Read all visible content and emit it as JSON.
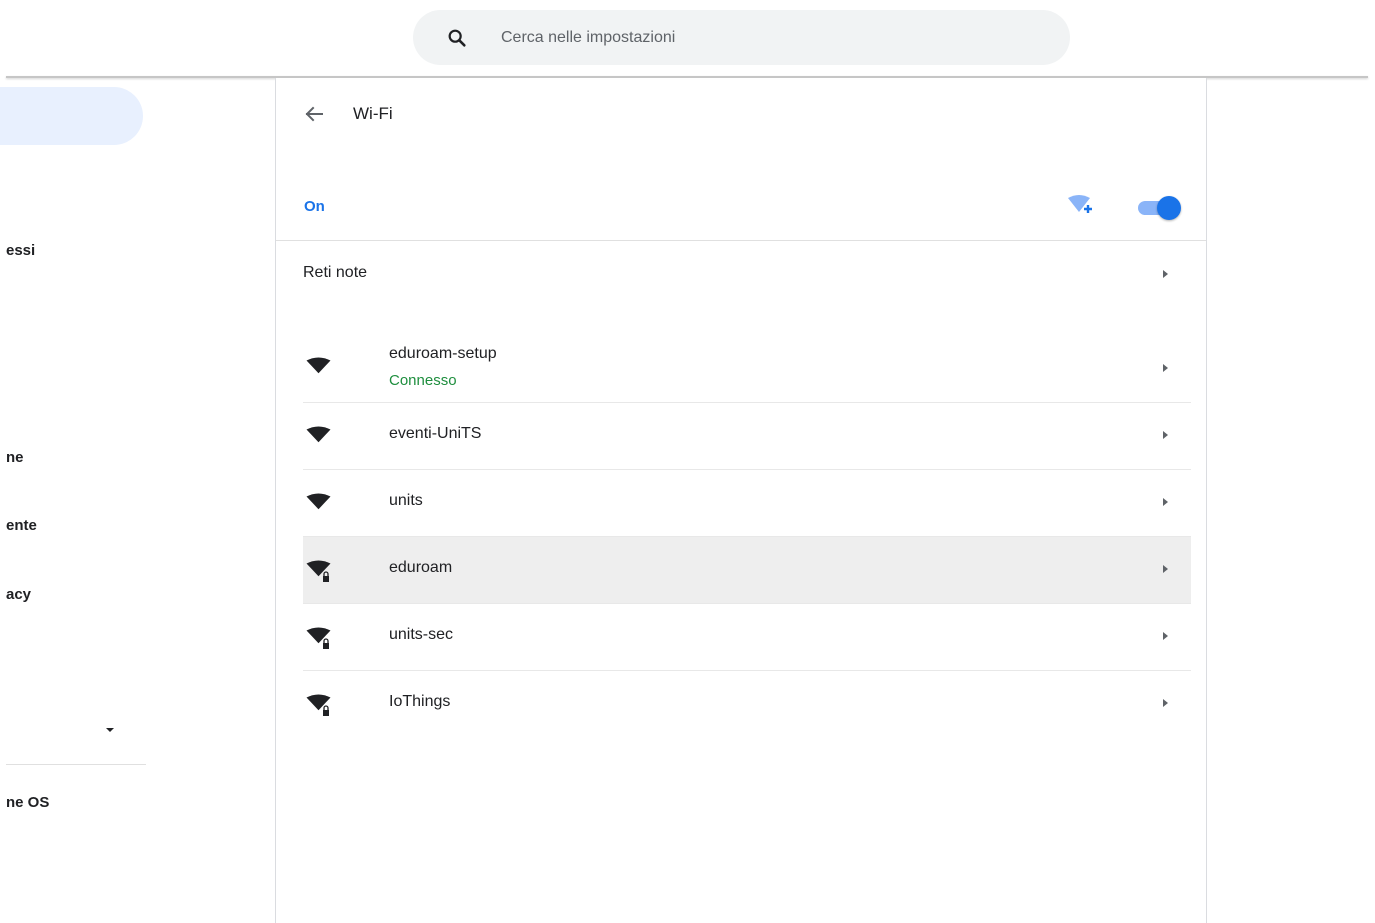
{
  "search": {
    "placeholder": "Cerca nelle impostazioni"
  },
  "sidebar": {
    "items": [
      {
        "label": "essi"
      },
      {
        "label": "ne"
      },
      {
        "label": "ente"
      },
      {
        "label": "acy"
      },
      {
        "label": "ne OS"
      }
    ]
  },
  "wifi": {
    "title": "Wi-Fi",
    "state_label": "On",
    "toggle_on": true,
    "known_networks_label": "Reti note",
    "networks": [
      {
        "name": "eduroam-setup",
        "status": "Connesso",
        "secured": false
      },
      {
        "name": "eventi-UniTS",
        "status": "",
        "secured": false
      },
      {
        "name": "units",
        "status": "",
        "secured": false
      },
      {
        "name": "eduroam",
        "status": "",
        "secured": true
      },
      {
        "name": "units-sec",
        "status": "",
        "secured": true
      },
      {
        "name": "IoThings",
        "status": "",
        "secured": true
      }
    ]
  },
  "colors": {
    "accent": "#1a73e8",
    "connected": "#1e8e3e",
    "sidebar_active": "#e8f0fe",
    "row_highlight": "#eeeeee"
  },
  "icons": {
    "search": "search-icon",
    "back": "arrow-back-icon",
    "add_network": "wifi-add-icon",
    "network": "wifi-signal-icon",
    "secured_network": "wifi-lock-icon",
    "chevron": "chevron-right-icon",
    "dropdown": "caret-down-icon"
  }
}
